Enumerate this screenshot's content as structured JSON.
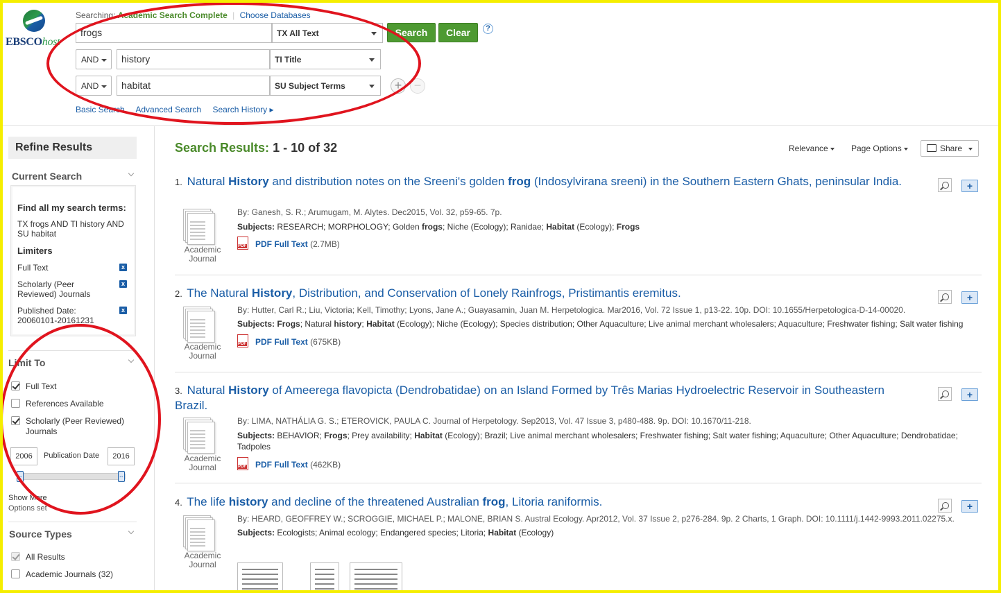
{
  "logo": {
    "text_main": "EBSCO",
    "text_sub": "host"
  },
  "header": {
    "searching_label": "Searching:",
    "database": "Academic Search Complete",
    "choose_databases": "Choose Databases",
    "rows": [
      {
        "bool": "",
        "term": "frogs",
        "field": "TX All Text"
      },
      {
        "bool": "AND",
        "term": "history",
        "field": "TI Title"
      },
      {
        "bool": "AND",
        "term": "habitat",
        "field": "SU Subject Terms"
      }
    ],
    "search_button": "Search",
    "clear_button": "Clear",
    "help": "?",
    "add": "+",
    "remove": "−",
    "links": {
      "basic": "Basic Search",
      "advanced": "Advanced Search",
      "history": "Search History ▸"
    }
  },
  "sidebar": {
    "refine_title": "Refine Results",
    "current_search": "Current Search",
    "find_all": "Find all my search terms:",
    "search_terms": "TX frogs AND TI history AND SU habitat",
    "limiters_title": "Limiters",
    "limiters": [
      "Full Text",
      "Scholarly (Peer Reviewed) Journals",
      "Published Date: 20060101-20161231"
    ],
    "remove_icon": "x",
    "limit_to": "Limit To",
    "limit_options": [
      {
        "label": "Full Text",
        "checked": true
      },
      {
        "label": "References Available",
        "checked": false
      },
      {
        "label": "Scholarly (Peer Reviewed) Journals",
        "checked": true
      }
    ],
    "date_from": "2006",
    "date_label": "Publication Date",
    "date_to": "2016",
    "show_more": "Show More",
    "options_set": "Options set",
    "source_types": "Source Types",
    "source_options": [
      {
        "label": "All Results",
        "checked": true
      },
      {
        "label": "Academic Journals (32)",
        "checked": false
      }
    ]
  },
  "results": {
    "label": "Search Results:",
    "count": "1 - 10 of 32",
    "relevance": "Relevance",
    "page_options": "Page Options",
    "share": "Share",
    "doc_type": [
      "Academic",
      "Journal"
    ],
    "items": [
      {
        "num": "1.",
        "title_parts": [
          [
            "Natural ",
            false
          ],
          [
            "History",
            true
          ],
          [
            " and distribution notes on the Sreeni's golden ",
            false
          ],
          [
            "frog",
            true
          ],
          [
            " (Indosylvirana sreeni) in the Southern Eastern Ghats, peninsular India.",
            false
          ]
        ],
        "meta": "By: Ganesh, S. R.; Arumugam, M. Alytes. Dec2015, Vol. 32, p59-65. 7p.",
        "subjects_parts": [
          [
            "Subjects: ",
            true
          ],
          [
            "RESEARCH; MORPHOLOGY; Golden ",
            false
          ],
          [
            "frogs",
            true
          ],
          [
            "; Niche (Ecology); Ranidae; ",
            false
          ],
          [
            "Habitat",
            true
          ],
          [
            " (Ecology); ",
            false
          ],
          [
            "Frogs",
            true
          ]
        ],
        "pdf": "PDF Full Text",
        "size": "(2.7MB)"
      },
      {
        "num": "2.",
        "title_parts": [
          [
            "The Natural ",
            false
          ],
          [
            "History",
            true
          ],
          [
            ", Distribution, and Conservation of Lonely Rainfrogs, Pristimantis eremitus.",
            false
          ]
        ],
        "meta": "By: Hutter, Carl R.; Liu, Victoria; Kell, Timothy; Lyons, Jane A.; Guayasamin, Juan M. Herpetologica. Mar2016, Vol. 72 Issue 1, p13-22. 10p. DOI: 10.1655/Herpetologica-D-14-00020.",
        "subjects_parts": [
          [
            "Subjects: ",
            true
          ],
          [
            "Frogs",
            true
          ],
          [
            "; Natural ",
            false
          ],
          [
            "history",
            true
          ],
          [
            "; ",
            false
          ],
          [
            "Habitat",
            true
          ],
          [
            " (Ecology); Niche (Ecology); Species distribution; Other Aquaculture; Live animal merchant wholesalers; Aquaculture; Freshwater fishing; Salt water fishing",
            false
          ]
        ],
        "pdf": "PDF Full Text",
        "size": "(675KB)"
      },
      {
        "num": "3.",
        "title_parts": [
          [
            "Natural ",
            false
          ],
          [
            "History",
            true
          ],
          [
            " of Ameerega flavopicta (Dendrobatidae) on an Island Formed by Três Marias Hydroelectric Reservoir in Southeastern Brazil.",
            false
          ]
        ],
        "meta": "By: LIMA, NATHÁLIA G. S.; ETEROVICK, PAULA C. Journal of Herpetology. Sep2013, Vol. 47 Issue 3, p480-488. 9p. DOI: 10.1670/11-218.",
        "subjects_parts": [
          [
            "Subjects: ",
            true
          ],
          [
            "BEHAVIOR; ",
            false
          ],
          [
            "Frogs",
            true
          ],
          [
            "; Prey availability; ",
            false
          ],
          [
            "Habitat",
            true
          ],
          [
            " (Ecology); Brazil; Live animal merchant wholesalers; Freshwater fishing; Salt water fishing; Aquaculture; Other Aquaculture; Dendrobatidae; Tadpoles",
            false
          ]
        ],
        "pdf": "PDF Full Text",
        "size": "(462KB)"
      },
      {
        "num": "4.",
        "title_parts": [
          [
            "The life ",
            false
          ],
          [
            "history",
            true
          ],
          [
            " and decline of the threatened Australian ",
            false
          ],
          [
            "frog",
            true
          ],
          [
            ", Litoria raniformis.",
            false
          ]
        ],
        "meta": "By: HEARD, GEOFFREY W.; SCROGGIE, MICHAEL P.; MALONE, BRIAN S. Austral Ecology. Apr2012, Vol. 37 Issue 2, p276-284. 9p. 2 Charts, 1 Graph. DOI: 10.1111/j.1442-9993.2011.02275.x.",
        "subjects_parts": [
          [
            "Subjects: ",
            true
          ],
          [
            "Ecologists; Animal ecology; Endangered species; Litoria; ",
            false
          ],
          [
            "Habitat",
            true
          ],
          [
            " (Ecology)",
            false
          ]
        ],
        "pdf": "",
        "size": ""
      }
    ]
  },
  "colors": {
    "accent_green": "#4e9a32",
    "link_blue": "#1a5da6",
    "annotation_red": "#e0141e",
    "frame_yellow": "#f5ee00"
  }
}
